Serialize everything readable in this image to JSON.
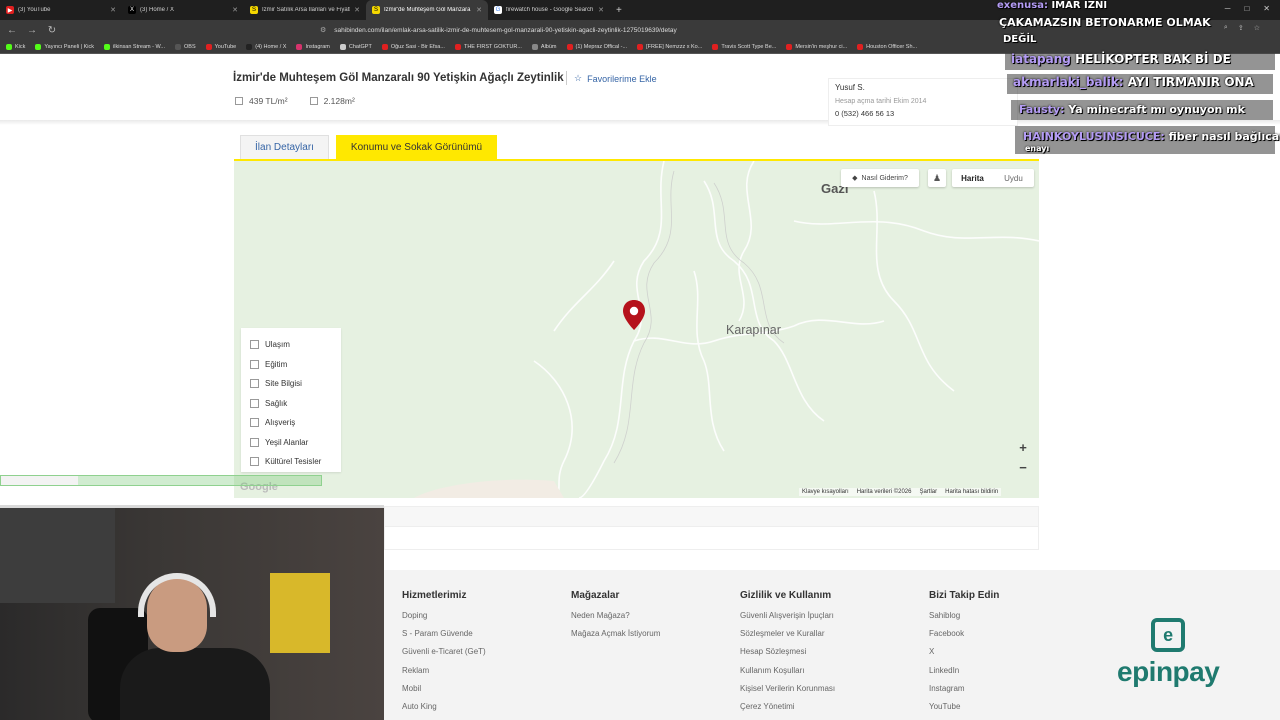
{
  "browser": {
    "tabs": [
      {
        "label": "(3) YouTube",
        "color": "#e02020",
        "active": false
      },
      {
        "label": "(3) Home / X",
        "color": "#222222",
        "active": false
      },
      {
        "label": "İzmir Satılık Arsa İlanları ve Fiyatları",
        "color": "#f5d800",
        "active": false
      },
      {
        "label": "İzmir'de Muhteşem Göl Manzara",
        "color": "#f5d800",
        "active": true
      },
      {
        "label": "firewatch house - Google Search",
        "color": "#ffffff",
        "active": false
      }
    ],
    "url": "sahibinden.com/ilan/emlak-arsa-satilik-izmir-de-muhtesem-gol-manzarali-90-yetiskin-agacli-zeytinlik-1275019639/detay",
    "bookmarks": [
      {
        "label": "Kick",
        "color": "#53fc18"
      },
      {
        "label": "Yayıncı Paneli | Kick",
        "color": "#53fc18"
      },
      {
        "label": "ilkinsan Stream - W...",
        "color": "#53fc18"
      },
      {
        "label": "OBS",
        "color": "#555555"
      },
      {
        "label": "YouTube",
        "color": "#e02020"
      },
      {
        "label": "(4) Home / X",
        "color": "#222222"
      },
      {
        "label": "Instagram",
        "color": "#d6336c"
      },
      {
        "label": "ChatGPT",
        "color": "#cccccc"
      },
      {
        "label": "Oğuz Sasi - Bir Efsa...",
        "color": "#e02020"
      },
      {
        "label": "THE FIRST GOKTUR...",
        "color": "#e02020"
      },
      {
        "label": "Albüm",
        "color": "#888888"
      },
      {
        "label": "(1) Mepraz Offical -...",
        "color": "#e02020"
      },
      {
        "label": "[FREE] Nemzzz x Ko...",
        "color": "#e02020"
      },
      {
        "label": "Travis Scott Type Be...",
        "color": "#e02020"
      },
      {
        "label": "Mersin'in meşhur ci...",
        "color": "#e02020"
      },
      {
        "label": "Houston Officer Sh...",
        "color": "#e02020"
      }
    ]
  },
  "listing": {
    "title": "İzmir'de Muhteşem Göl Manzaralı 90 Yetişkin Ağaçlı Zeytinlik",
    "favorite_label": "Favorilerime Ekle",
    "price_per_m2": "439 TL/m²",
    "area": "2.128m²"
  },
  "seller": {
    "name": "Yusuf S.",
    "since": "Hesap açma tarihi  Ekim 2014",
    "phone": "0 (532) 466 56 13"
  },
  "tabs": {
    "details": "İlan Detayları",
    "location": "Konumu ve Sokak Görünümü"
  },
  "map": {
    "place_top": "Gazi",
    "place_center": "Karapınar",
    "route_button": "Nasıl Giderim?",
    "type_map": "Harita",
    "type_satellite": "Uydu",
    "zoom_in": "+",
    "zoom_out": "−",
    "google": "Google",
    "footer": [
      "Klavye kısayolları",
      "Harita verileri ©2026",
      "Şartlar",
      "Harita hatası bildirin"
    ],
    "poi": [
      "Ulaşım",
      "Eğitim",
      "Site Bilgisi",
      "Sağlık",
      "Alışveriş",
      "Yeşil Alanlar",
      "Kültürel Tesisler"
    ],
    "pin_color": "#b5121b",
    "land_color": "#e6f1e1"
  },
  "footer": {
    "columns": [
      {
        "title": "Hizmetlerimiz",
        "links": [
          "Doping",
          "S - Param Güvende",
          "Güvenli e-Ticaret (GeT)",
          "Reklam",
          "Mobil",
          "Auto King"
        ]
      },
      {
        "title": "Mağazalar",
        "links": [
          "Neden Mağaza?",
          "Mağaza Açmak İstiyorum"
        ]
      },
      {
        "title": "Gizlilik ve Kullanım",
        "links": [
          "Güvenli Alışverişin İpuçları",
          "Sözleşmeler ve Kurallar",
          "Hesap Sözleşmesi",
          "Kullanım Koşulları",
          "Kişisel Verilerin Korunması",
          "Çerez Yönetimi"
        ]
      },
      {
        "title": "Bizi Takip Edin",
        "links": [
          "Sahiblog",
          "Facebook",
          "X",
          "LinkedIn",
          "Instagram",
          "YouTube"
        ]
      }
    ],
    "brand": "epinpay",
    "brand_color": "#1f7a6f"
  },
  "stream": {
    "chat": [
      {
        "user": "exenusa:",
        "text": "İMAR İZNİ"
      },
      {
        "user": "",
        "text": "ÇAKAMAZSIN BETONARME OLMAK"
      },
      {
        "user": "",
        "text": "DEĞİL"
      },
      {
        "user": "iatapang",
        "text": "HELİKOPTER BAK Bİ DE"
      },
      {
        "user": "akmarlaki_balik:",
        "text": "AYI TIRMANIR ONA"
      },
      {
        "user": "Fausty:",
        "text": "Ya minecraft mı oynuyon mk"
      },
      {
        "user": "HAINKOYLUSINSICUCE:",
        "text": "fiber nasıl bağlıcan"
      },
      {
        "user": "",
        "text": "enayı"
      }
    ],
    "progress": 0.24
  }
}
